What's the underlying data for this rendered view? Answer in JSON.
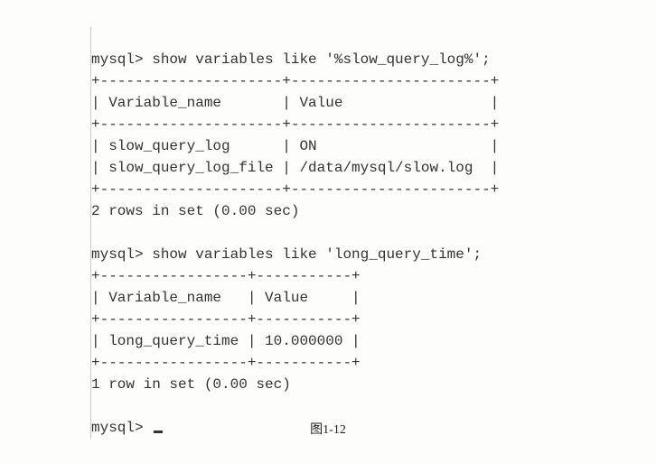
{
  "terminal": {
    "block1": {
      "cmd": "mysql> show variables like '%slow_query_log%';",
      "sep_top": "+---------------------+-----------------------+",
      "header": "| Variable_name       | Value                 |",
      "sep_mid": "+---------------------+-----------------------+",
      "row1": "| slow_query_log      | ON                    |",
      "row2": "| slow_query_log_file | /data/mysql/slow.log  |",
      "sep_bot": "+---------------------+-----------------------+",
      "footer": "2 rows in set (0.00 sec)"
    },
    "block2": {
      "cmd": "mysql> show variables like 'long_query_time';",
      "sep_top": "+-----------------+-----------+",
      "header": "| Variable_name   | Value     |",
      "sep_mid": "+-----------------+-----------+",
      "row1": "| long_query_time | 10.000000 |",
      "sep_bot": "+-----------------+-----------+",
      "footer": "1 row in set (0.00 sec)"
    },
    "prompt": "mysql> "
  },
  "caption": "图1-12",
  "chart_data": {
    "type": "table",
    "tables": [
      {
        "query": "show variables like '%slow_query_log%'",
        "columns": [
          "Variable_name",
          "Value"
        ],
        "rows": [
          [
            "slow_query_log",
            "ON"
          ],
          [
            "slow_query_log_file",
            "/data/mysql/slow.log"
          ]
        ],
        "rows_in_set": 2,
        "time_sec": 0.0
      },
      {
        "query": "show variables like 'long_query_time'",
        "columns": [
          "Variable_name",
          "Value"
        ],
        "rows": [
          [
            "long_query_time",
            "10.000000"
          ]
        ],
        "rows_in_set": 1,
        "time_sec": 0.0
      }
    ]
  }
}
